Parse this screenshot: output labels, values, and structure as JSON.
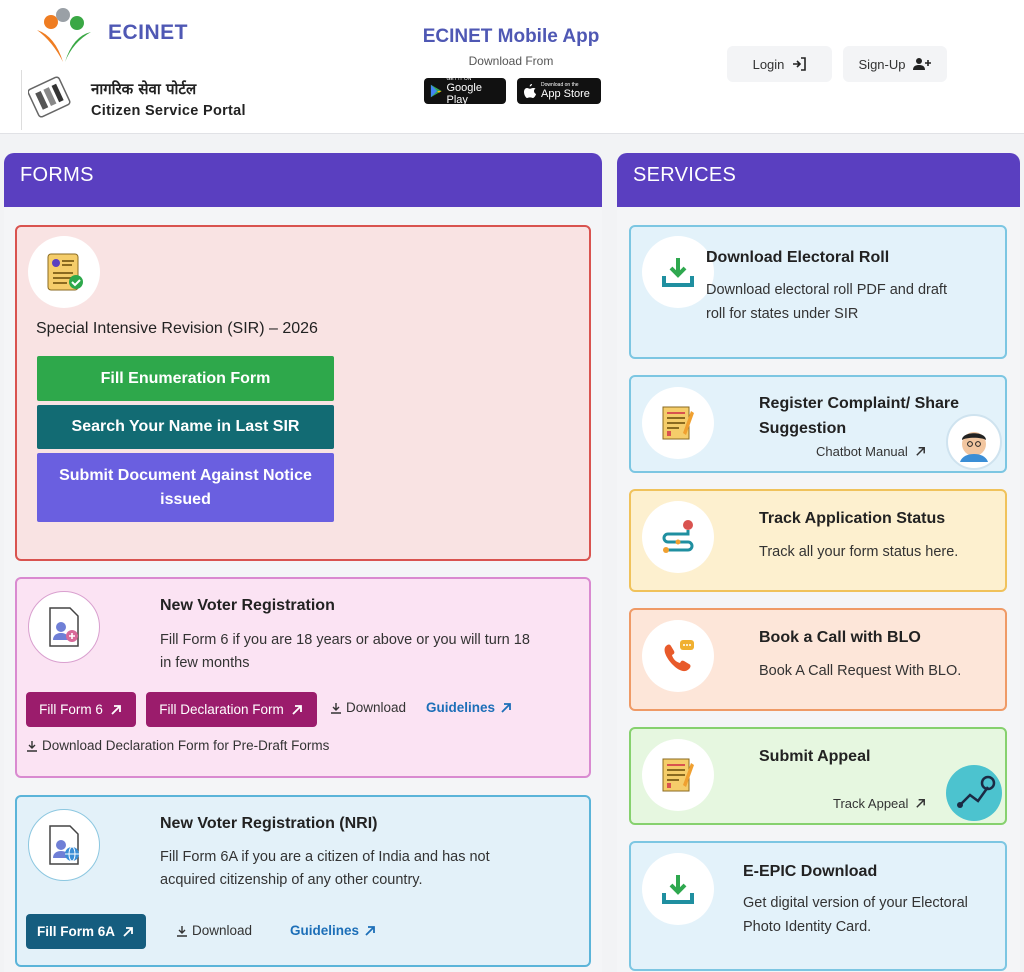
{
  "header": {
    "brand": "ECINET",
    "hindi_title": "नागरिक सेवा पोर्टल",
    "portal_title": "Citizen Service Portal",
    "app_title": "ECINET Mobile App",
    "download_from": "Download From",
    "google_play": {
      "small": "GET IT ON",
      "big": "Google Play"
    },
    "app_store": {
      "small": "Download on the",
      "big": "App Store"
    },
    "login_label": "Login",
    "signup_label": "Sign-Up"
  },
  "forms": {
    "heading": "FORMS",
    "sir": {
      "title": "Special Intensive Revision (SIR) – 2026",
      "btn_enumeration": "Fill Enumeration Form",
      "btn_search": "Search Your Name in Last SIR",
      "btn_submit_doc": "Submit Document Against Notice issued"
    },
    "new_voter": {
      "title": "New Voter Registration",
      "desc": "Fill Form 6 if you are 18 years or above or you will turn 18 in few months",
      "btn_form6": "Fill Form 6",
      "btn_declaration": "Fill Declaration Form",
      "download": "Download",
      "guidelines": "Guidelines",
      "download_decl": "Download Declaration Form for Pre-Draft Forms"
    },
    "nri": {
      "title": "New Voter Registration (NRI)",
      "desc": "Fill Form 6A if you are a citizen of India and has not acquired citizenship of any other country.",
      "btn_form6a": "Fill Form 6A",
      "download": "Download",
      "guidelines": "Guidelines"
    }
  },
  "services": {
    "heading": "SERVICES",
    "electoral_roll": {
      "title": "Download Electoral Roll",
      "desc": "Download electoral roll PDF and draft roll for states under SIR"
    },
    "complaint": {
      "title": "Register Complaint/ Share Suggestion",
      "link": "Chatbot Manual"
    },
    "track": {
      "title": "Track Application Status",
      "desc": "Track all your form status here."
    },
    "blo": {
      "title": "Book a Call with BLO",
      "desc": "Book A Call Request With BLO."
    },
    "appeal": {
      "title": "Submit Appeal",
      "link": "Track Appeal"
    },
    "epic": {
      "title": "E-EPIC Download",
      "desc": "Get digital version of your Electoral Photo Identity Card."
    }
  },
  "colors": {
    "header_purple": "#5a3fc0",
    "brand_blue": "#4f58b4",
    "green": "#2ea84b",
    "teal": "#126b73",
    "violet": "#6a5fe0",
    "magenta": "#9b1c6c"
  }
}
